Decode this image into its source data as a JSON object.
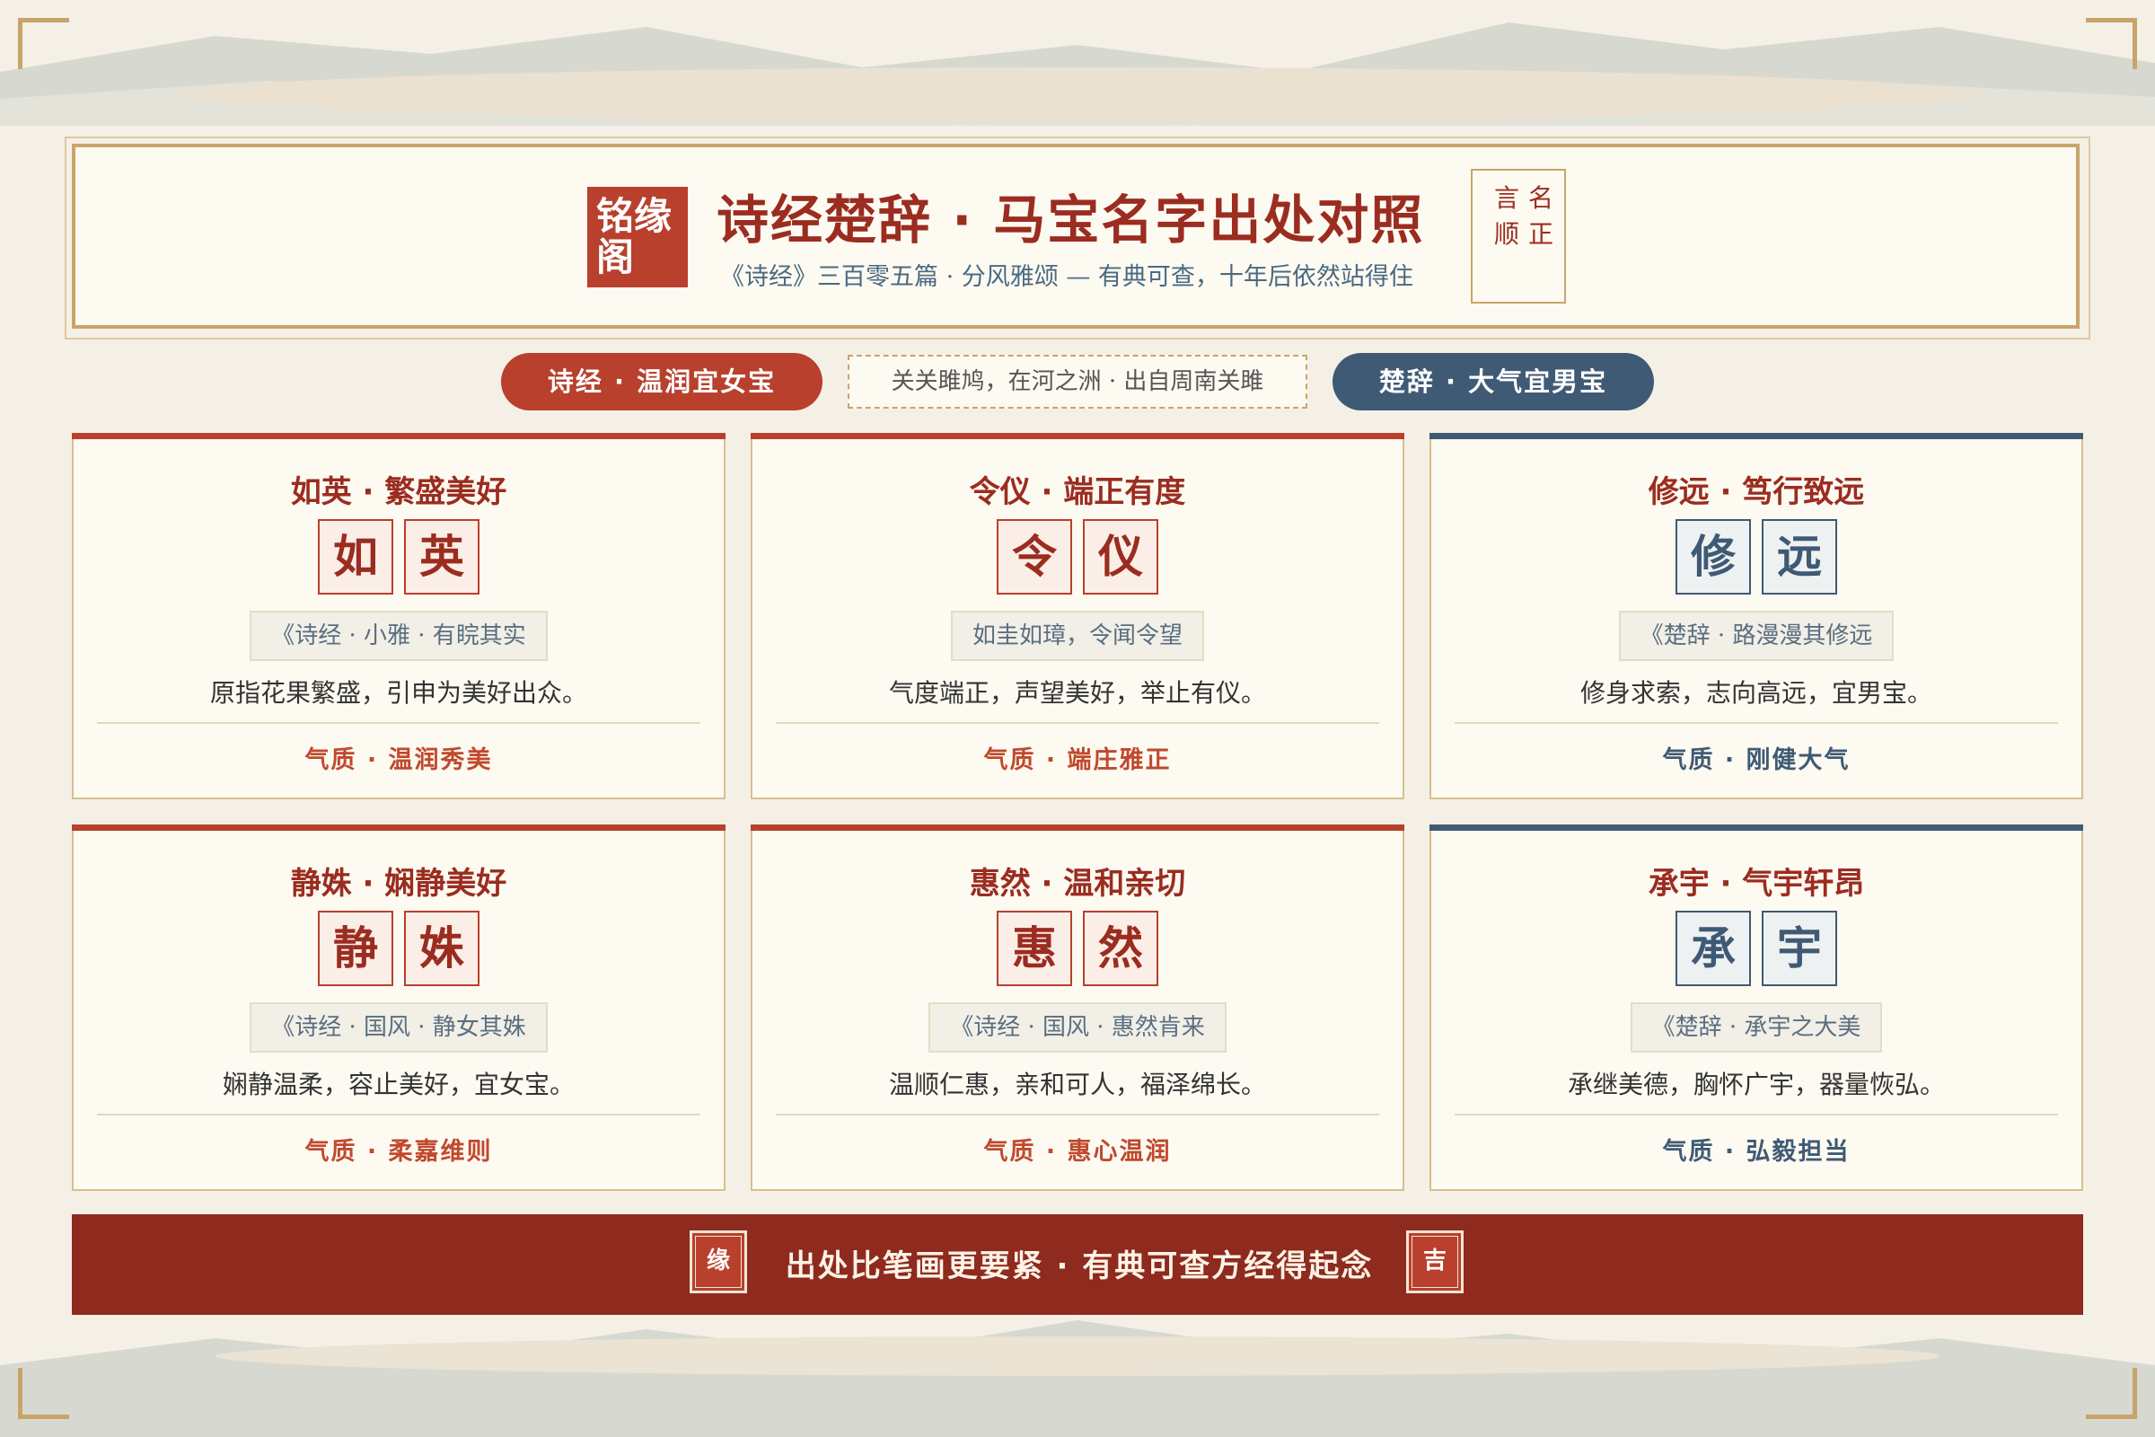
{
  "header": {
    "seal_text": "铭缘阁",
    "title": "诗经楚辞 · 马宝名字出处对照",
    "subtitle": "《诗经》三百零五篇 · 分风雅颂 — 有典可查，十年后依然站得住",
    "motto": [
      "言",
      "名",
      "顺",
      "正"
    ]
  },
  "tabs": {
    "left_pill": "诗经 · 温润宜女宝",
    "center_quote": "关关雎鸠，在河之洲 · 出自周南关雎",
    "right_pill": "楚辞 · 大气宜男宝"
  },
  "cards": [
    {
      "title": "如英 · 繁盛美好",
      "chars": [
        "如",
        "英"
      ],
      "source": "《诗经 · 小雅 · 有睆其实",
      "meaning": "原指花果繁盛，引申为美好出众。",
      "temper": "气质 · 温润秀美",
      "theme": "red"
    },
    {
      "title": "令仪 · 端正有度",
      "chars": [
        "令",
        "仪"
      ],
      "source": "如圭如璋，令闻令望",
      "meaning": "气度端正，声望美好，举止有仪。",
      "temper": "气质 · 端庄雅正",
      "theme": "red"
    },
    {
      "title": "修远 · 笃行致远",
      "chars": [
        "修",
        "远"
      ],
      "source": "《楚辞 · 路漫漫其修远",
      "meaning": "修身求索，志向高远，宜男宝。",
      "temper": "气质 · 刚健大气",
      "theme": "blue"
    },
    {
      "title": "静姝 · 娴静美好",
      "chars": [
        "静",
        "姝"
      ],
      "source": "《诗经 · 国风 · 静女其姝",
      "meaning": "娴静温柔，容止美好，宜女宝。",
      "temper": "气质 · 柔嘉维则",
      "theme": "red"
    },
    {
      "title": "惠然 · 温和亲切",
      "chars": [
        "惠",
        "然"
      ],
      "source": "《诗经 · 国风 · 惠然肯来",
      "meaning": "温顺仁惠，亲和可人，福泽绵长。",
      "temper": "气质 · 惠心温润",
      "theme": "red"
    },
    {
      "title": "承宇 · 气宇轩昂",
      "chars": [
        "承",
        "宇"
      ],
      "source": "《楚辞 · 承宇之大美",
      "meaning": "承继美德，胸怀广宇，器量恢弘。",
      "temper": "气质 · 弘毅担当",
      "theme": "blue"
    }
  ],
  "footer": {
    "left_stamp": "缘",
    "text": "出处比笔画更要紧 · 有典可查方经得起念",
    "right_stamp": "吉"
  },
  "colors": {
    "accent_red": "#b8402d",
    "deep_red": "#8e2a1e",
    "accent_blue": "#3f5a74",
    "gold": "#c9a46a",
    "background": "#f5f0e6"
  }
}
